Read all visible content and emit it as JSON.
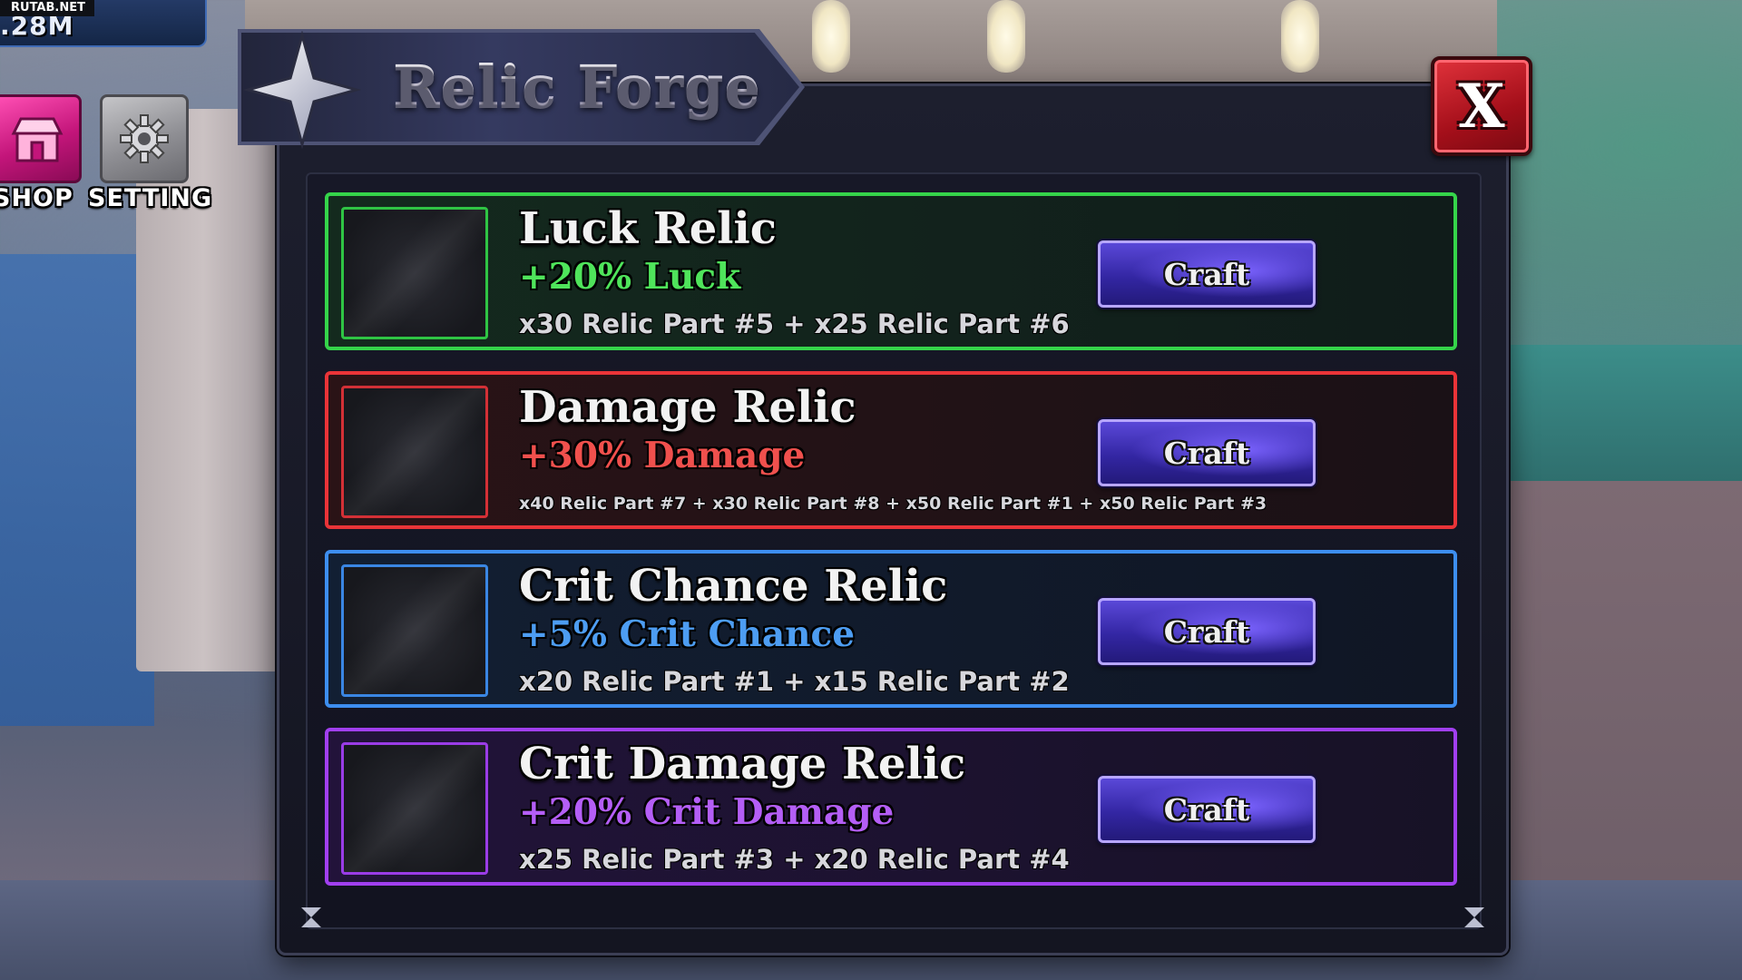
{
  "watermark": "RUTAB.NET",
  "hud": {
    "currency_value": ".28M",
    "shop_label": "SHOP",
    "setting_label": "SETTING"
  },
  "panel": {
    "title": "Relic Forge",
    "close_label": "X"
  },
  "relics": [
    {
      "name": "Luck Relic",
      "bonus": "+20% Luck",
      "cost": "x30 Relic Part #5 + x25 Relic Part #6",
      "button_label": "Craft",
      "color": "#35d44a"
    },
    {
      "name": "Damage Relic",
      "bonus": "+30% Damage",
      "cost": "x40 Relic Part #7 + x30 Relic Part #8 + x50 Relic Part #1 + x50 Relic Part #3",
      "button_label": "Craft",
      "color": "#ea3438"
    },
    {
      "name": "Crit Chance Relic",
      "bonus": "+5% Crit Chance",
      "cost": "x20 Relic Part #1 + x15 Relic Part #2",
      "button_label": "Craft",
      "color": "#3d8ef0"
    },
    {
      "name": "Crit Damage Relic",
      "bonus": "+20% Crit Damage",
      "cost": "x25 Relic Part #3 + x20 Relic Part #4",
      "button_label": "Craft",
      "color": "#a13ff0"
    }
  ]
}
